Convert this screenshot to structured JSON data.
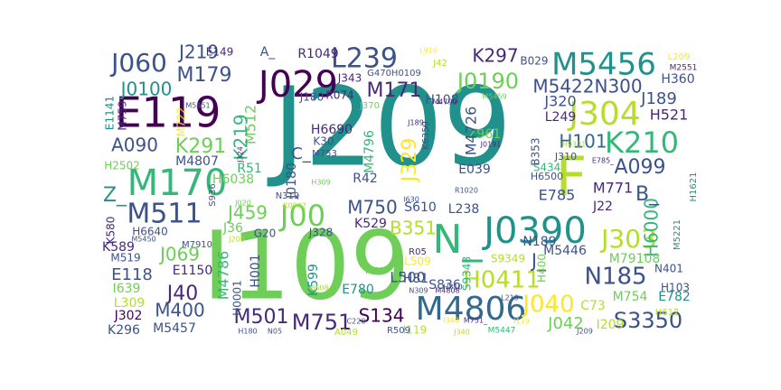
{
  "palette": {
    "dark_purple": "#440154",
    "purple": "#482878",
    "indigo": "#3b528b",
    "slate": "#31688e",
    "teal": "#21918c",
    "green_teal": "#35b779",
    "green": "#6ece58",
    "lime": "#b5de2b",
    "yellow": "#fde725"
  },
  "words": [
    {
      "text": "J209",
      "color": "teal"
    },
    {
      "text": "I109",
      "color": "green"
    },
    {
      "text": "F",
      "color": "lime"
    },
    {
      "text": "M5456",
      "color": "teal"
    },
    {
      "text": "E119",
      "color": "dark_purple"
    },
    {
      "text": "M170",
      "color": "green_teal"
    },
    {
      "text": "J304",
      "color": "lime"
    },
    {
      "text": "J029",
      "color": "dark_purple"
    },
    {
      "text": "M4806",
      "color": "slate"
    },
    {
      "text": "J0390",
      "color": "teal"
    },
    {
      "text": "N_",
      "color": "green_teal"
    },
    {
      "text": "K210",
      "color": "green_teal"
    },
    {
      "text": "L239",
      "color": "indigo"
    },
    {
      "text": "M511",
      "color": "indigo"
    },
    {
      "text": "J060",
      "color": "indigo"
    },
    {
      "text": "J00",
      "color": "green"
    },
    {
      "text": "J303",
      "color": "lime"
    },
    {
      "text": "S3350",
      "color": "indigo"
    },
    {
      "text": "N185",
      "color": "indigo"
    },
    {
      "text": "H0411",
      "color": "lime"
    },
    {
      "text": "J0190",
      "color": "green"
    },
    {
      "text": "A099",
      "color": "indigo"
    },
    {
      "text": "M171",
      "color": "purple"
    },
    {
      "text": "M750",
      "color": "indigo"
    },
    {
      "text": "J0100",
      "color": "teal"
    },
    {
      "text": "M179",
      "color": "indigo"
    },
    {
      "text": "J219",
      "color": "indigo"
    },
    {
      "text": "K297",
      "color": "purple"
    },
    {
      "text": "M5422N300",
      "color": "indigo"
    },
    {
      "text": "H101",
      "color": "slate"
    },
    {
      "text": "M771",
      "color": "purple"
    },
    {
      "text": "J40",
      "color": "purple"
    },
    {
      "text": "M400",
      "color": "indigo"
    },
    {
      "text": "M501",
      "color": "purple"
    },
    {
      "text": "M751",
      "color": "purple"
    },
    {
      "text": "S134",
      "color": "dark_purple"
    },
    {
      "text": "J040",
      "color": "yellow"
    },
    {
      "text": "J042",
      "color": "green"
    },
    {
      "text": "J069",
      "color": "green"
    },
    {
      "text": "A090",
      "color": "indigo"
    },
    {
      "text": "K291",
      "color": "green"
    },
    {
      "text": "J459",
      "color": "green"
    },
    {
      "text": "E118",
      "color": "indigo"
    },
    {
      "text": "B351",
      "color": "lime"
    },
    {
      "text": "J189",
      "color": "indigo"
    },
    {
      "text": "H521",
      "color": "purple"
    },
    {
      "text": "H360",
      "color": "indigo"
    },
    {
      "text": "H6000",
      "color": "green_teal"
    },
    {
      "text": "B_",
      "color": "indigo"
    },
    {
      "text": "J_",
      "color": "indigo"
    },
    {
      "text": "I639",
      "color": "green"
    },
    {
      "text": "L309",
      "color": "lime"
    },
    {
      "text": "J302",
      "color": "dark_purple"
    },
    {
      "text": "K296",
      "color": "indigo"
    },
    {
      "text": "M5457",
      "color": "indigo"
    },
    {
      "text": "E1150",
      "color": "purple"
    },
    {
      "text": "M4807",
      "color": "indigo"
    },
    {
      "text": "M4786",
      "color": "green_teal"
    },
    {
      "text": "H001",
      "color": "indigo"
    },
    {
      "text": "K599",
      "color": "teal"
    },
    {
      "text": "E780",
      "color": "teal"
    },
    {
      "text": "L500",
      "color": "indigo"
    },
    {
      "text": "S836",
      "color": "indigo"
    },
    {
      "text": "H400",
      "color": "green"
    },
    {
      "text": "C73",
      "color": "lime"
    },
    {
      "text": "I209",
      "color": "lime"
    },
    {
      "text": "M754",
      "color": "green"
    },
    {
      "text": "E782",
      "color": "teal"
    },
    {
      "text": "H103",
      "color": "indigo"
    },
    {
      "text": "N401",
      "color": "indigo"
    },
    {
      "text": "M79108",
      "color": "green"
    },
    {
      "text": "M5446",
      "color": "indigo"
    },
    {
      "text": "N189",
      "color": "indigo"
    },
    {
      "text": "S9349",
      "color": "lime"
    },
    {
      "text": "L238",
      "color": "indigo"
    },
    {
      "text": "S610",
      "color": "indigo"
    },
    {
      "text": "E785",
      "color": "indigo"
    },
    {
      "text": "J22",
      "color": "purple"
    },
    {
      "text": "R42",
      "color": "indigo"
    },
    {
      "text": "E039",
      "color": "indigo"
    },
    {
      "text": "J320",
      "color": "indigo"
    },
    {
      "text": "L249",
      "color": "purple"
    },
    {
      "text": "Z961",
      "color": "green"
    },
    {
      "text": "H108",
      "color": "indigo"
    },
    {
      "text": "M4726",
      "color": "indigo"
    },
    {
      "text": "J329",
      "color": "yellow"
    },
    {
      "text": "M4796",
      "color": "green_teal"
    },
    {
      "text": "H6690",
      "color": "purple"
    },
    {
      "text": "K30",
      "color": "indigo"
    },
    {
      "text": "J0180",
      "color": "indigo"
    },
    {
      "text": "R074",
      "color": "purple"
    },
    {
      "text": "J180",
      "color": "indigo"
    },
    {
      "text": "J343",
      "color": "purple"
    },
    {
      "text": "R1049",
      "color": "purple"
    },
    {
      "text": "A_",
      "color": "indigo"
    },
    {
      "text": "E149",
      "color": "purple"
    },
    {
      "text": "M512",
      "color": "green"
    },
    {
      "text": "K219",
      "color": "green_teal"
    },
    {
      "text": "M722",
      "color": "yellow"
    },
    {
      "text": "E1141",
      "color": "teal"
    },
    {
      "text": "M759",
      "color": "purple"
    },
    {
      "text": "H2502",
      "color": "green"
    },
    {
      "text": "R51",
      "color": "green_teal"
    },
    {
      "text": "H6038",
      "color": "green"
    },
    {
      "text": "Z_",
      "color": "teal"
    },
    {
      "text": "K580",
      "color": "purple"
    },
    {
      "text": "H6640",
      "color": "indigo"
    },
    {
      "text": "K589",
      "color": "purple"
    },
    {
      "text": "M519",
      "color": "indigo"
    },
    {
      "text": "J36",
      "color": "green"
    },
    {
      "text": "G20",
      "color": "indigo"
    },
    {
      "text": "J328",
      "color": "indigo"
    },
    {
      "text": "K529",
      "color": "purple"
    },
    {
      "text": "L509",
      "color": "yellow"
    },
    {
      "text": "H81",
      "color": "indigo"
    },
    {
      "text": "C_",
      "color": "indigo"
    },
    {
      "text": "B029",
      "color": "indigo"
    },
    {
      "text": "L209",
      "color": "yellow"
    },
    {
      "text": "M2551",
      "color": "purple"
    },
    {
      "text": "I119",
      "color": "lime"
    },
    {
      "text": "A049",
      "color": "lime"
    },
    {
      "text": "R509",
      "color": "indigo"
    },
    {
      "text": "M5447",
      "color": "green_teal"
    },
    {
      "text": "N319",
      "color": "indigo"
    },
    {
      "text": "H0001",
      "color": "indigo"
    },
    {
      "text": "G470H0109",
      "color": "indigo"
    },
    {
      "text": "J370",
      "color": "green"
    },
    {
      "text": "S434",
      "color": "green_teal"
    },
    {
      "text": "H6500",
      "color": "indigo"
    },
    {
      "text": "B353",
      "color": "indigo"
    },
    {
      "text": "J310",
      "color": "indigo"
    },
    {
      "text": "H1621",
      "color": "teal"
    },
    {
      "text": "M5221",
      "color": "teal"
    },
    {
      "text": "H612",
      "color": "lime"
    },
    {
      "text": "R05",
      "color": "purple"
    },
    {
      "text": "S9348",
      "color": "green_teal"
    },
    {
      "text": "K6359",
      "color": "indigo"
    },
    {
      "text": "J189_",
      "color": "purple"
    },
    {
      "text": "J42",
      "color": "lime"
    },
    {
      "text": "M4799",
      "color": "purple"
    },
    {
      "text": "M5459",
      "color": "green"
    },
    {
      "text": "I340",
      "color": "yellow"
    },
    {
      "text": "L910",
      "color": "yellow"
    },
    {
      "text": "J0191",
      "color": "purple"
    },
    {
      "text": "M753",
      "color": "indigo"
    },
    {
      "text": "M7910",
      "color": "indigo"
    },
    {
      "text": "H608",
      "color": "lime"
    },
    {
      "text": "L219",
      "color": "indigo"
    },
    {
      "text": "I119",
      "color": "yellow"
    },
    {
      "text": "I10",
      "color": "green"
    },
    {
      "text": "C220",
      "color": "indigo"
    },
    {
      "text": "M751_",
      "color": "purple"
    },
    {
      "text": "H309",
      "color": "green"
    },
    {
      "text": "K0902",
      "color": "lime"
    },
    {
      "text": "H810",
      "color": "indigo"
    },
    {
      "text": "J340",
      "color": "lime"
    },
    {
      "text": "J209",
      "color": "indigo"
    },
    {
      "text": "M5450",
      "color": "indigo"
    },
    {
      "text": "J200",
      "color": "lime"
    },
    {
      "text": "S936",
      "color": "indigo"
    },
    {
      "text": "H180",
      "color": "indigo"
    },
    {
      "text": "J324",
      "color": "purple"
    },
    {
      "text": "M5451",
      "color": "indigo"
    },
    {
      "text": "J020",
      "color": "green"
    },
    {
      "text": "N309",
      "color": "indigo"
    },
    {
      "text": "M4808",
      "color": "purple"
    },
    {
      "text": "R1020",
      "color": "indigo"
    },
    {
      "text": "I630",
      "color": "indigo"
    },
    {
      "text": "N05",
      "color": "indigo"
    },
    {
      "text": "H9331",
      "color": "lime"
    },
    {
      "text": "E785_",
      "color": "purple"
    }
  ]
}
